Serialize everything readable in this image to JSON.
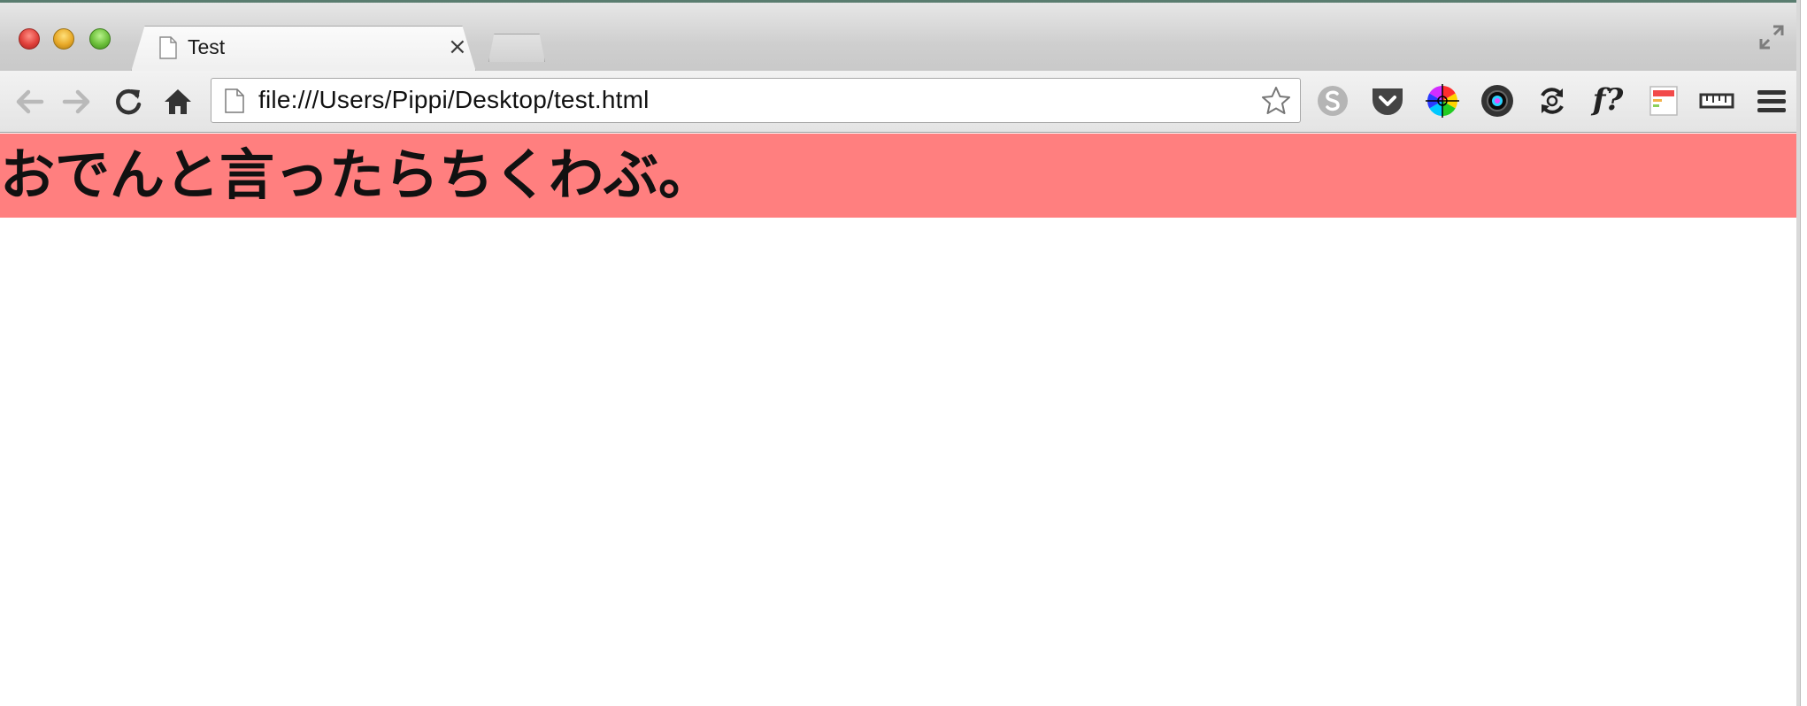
{
  "window": {
    "controls": [
      "close",
      "minimize",
      "zoom"
    ]
  },
  "tabs": [
    {
      "title": "Test",
      "icon": "page-icon",
      "close_label": "×",
      "active": true
    }
  ],
  "toolbar": {
    "back_icon": "arrow-left-icon",
    "forward_icon": "arrow-right-icon",
    "reload_icon": "reload-icon",
    "home_icon": "home-icon",
    "url": "file:///Users/Pippi/Desktop/test.html",
    "bookmark_icon": "star-icon"
  },
  "extensions": [
    {
      "name": "skype-icon"
    },
    {
      "name": "pocket-icon"
    },
    {
      "name": "color-wheel-icon"
    },
    {
      "name": "camera-lens-icon"
    },
    {
      "name": "sync-icon"
    },
    {
      "name": "fonts-question-icon",
      "label": "f?"
    },
    {
      "name": "layout-icon"
    },
    {
      "name": "ruler-icon"
    },
    {
      "name": "menu-icon"
    }
  ],
  "page": {
    "heading": "おでんと言ったらちくわぶ。",
    "banner_color": "#ff7f7f"
  }
}
